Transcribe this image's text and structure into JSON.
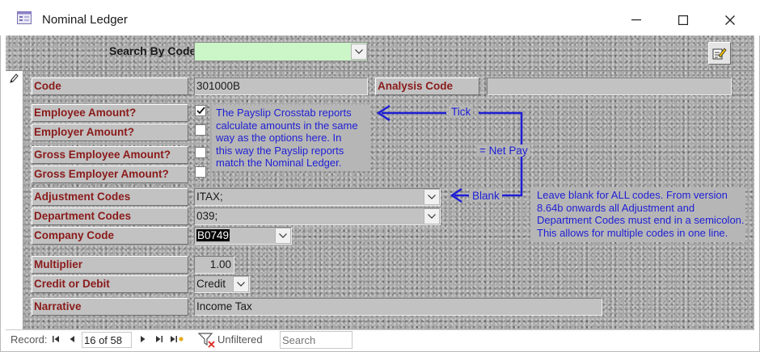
{
  "window": {
    "title": "Nominal Ledger"
  },
  "search": {
    "label": "Search By Code",
    "value": ""
  },
  "fields": {
    "code": {
      "label": "Code",
      "value": "301000B"
    },
    "analysis_code": {
      "label": "Analysis Code",
      "value": ""
    },
    "employee_amount": {
      "label": "Employee Amount?",
      "checked": true
    },
    "employer_amount": {
      "label": "Employer Amount?",
      "checked": false
    },
    "gross_employee_amount": {
      "label": "Gross Employee Amount?",
      "checked": false
    },
    "gross_employer_amount": {
      "label": "Gross Employer Amount?",
      "checked": false
    },
    "adjustment_codes": {
      "label": "Adjustment Codes",
      "value": "ITAX;"
    },
    "department_codes": {
      "label": "Department Codes",
      "value": "039;"
    },
    "company_code": {
      "label": "Company Code",
      "value": "B0749"
    },
    "multiplier": {
      "label": "Multiplier",
      "value": "1.00"
    },
    "credit_or_debit": {
      "label": "Credit or Debit",
      "value": "Credit"
    },
    "narrative": {
      "label": "Narrative",
      "value": "Income Tax"
    }
  },
  "notes": {
    "payslip": [
      "The Payslip Crosstab reports",
      "calculate amounts in the same",
      "way as the options here.  In",
      "this way the Payslip reports",
      "match the Nominal Ledger."
    ],
    "codes": [
      "Leave blank for ALL codes. From version",
      "8.64b onwards all Adjustment and",
      "Department Codes must end in a semicolon.",
      "This allows for multiple codes in one line."
    ]
  },
  "annotations": {
    "tick": "Tick",
    "net_pay": "= Net Pay",
    "blank": "Blank"
  },
  "statusbar": {
    "record_label": "Record:",
    "record_position": "16 of 58",
    "filter_label": "Unfiltered",
    "search_placeholder": "Search"
  },
  "colors": {
    "label_text": "#8b1a1a",
    "note_text": "#1e1ed6",
    "search_bg": "#ccf5c8",
    "arrow": "#1e1ed6"
  },
  "icons": [
    "form-icon",
    "minimize-icon",
    "maximize-icon",
    "close-icon",
    "edit-icon",
    "pencil-icon",
    "dropdown-arrow-icon",
    "checkmark-icon",
    "first-record-icon",
    "previous-record-icon",
    "next-record-icon",
    "last-record-icon",
    "new-record-icon",
    "filter-icon"
  ]
}
